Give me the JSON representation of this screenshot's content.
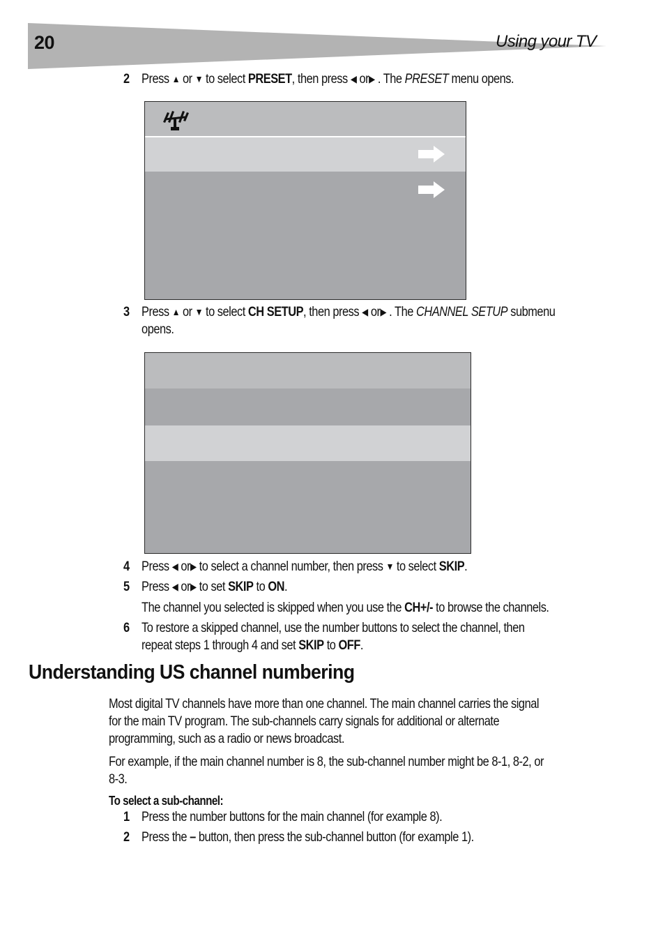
{
  "header": {
    "page_number": "20",
    "running_head": "Using your TV",
    "band_color": "#b3b3b3"
  },
  "steps_a": [
    {
      "number": "2",
      "parts": {
        "p1": "Press ",
        "up_icon": "▲",
        "p2": " or ",
        "down_icon": "▼",
        "p3": " to select ",
        "b1": "PRESET",
        "p4": ", then press ",
        "left_icon": "◀",
        "p5": " or",
        "right_icon": "▶",
        "p6": " . The ",
        "i1": "PRESET",
        "p7": " menu opens."
      }
    },
    {
      "number": "3",
      "parts": {
        "p1": "Press ",
        "up_icon": "▲",
        "p2": " or ",
        "down_icon": "▼",
        "p3": " to select ",
        "b1": "CH SETUP",
        "p4": ", then press ",
        "left_icon": "◀",
        "p5": " or",
        "right_icon": "▶",
        "p6": " . The ",
        "i1": "CHANNEL SETUP",
        "p7": " submenu",
        "line2": "opens."
      }
    }
  ],
  "preset_screen": {
    "header_icon": "antenna-icon",
    "rows": [
      {
        "state": "selected",
        "icon": "arrow-right-icon"
      },
      {
        "state": "normal",
        "icon": "arrow-right-icon"
      }
    ],
    "colors": {
      "header": "#bbbcbe",
      "selected": "#d1d2d4",
      "body": "#a7a8ab"
    }
  },
  "channel_setup_screen": {
    "rows": [
      {
        "state": "header"
      },
      {
        "state": "normal"
      },
      {
        "state": "selected"
      },
      {
        "state": "normal"
      }
    ]
  },
  "steps_b": [
    {
      "number": "4",
      "parts": {
        "p1": "Press ",
        "left_icon": "◀",
        "p2": " or",
        "right_icon": "▶",
        "p3": "  to select a channel number, then press ",
        "down_icon": "▼",
        "p4": "  to select ",
        "b1": "SKIP",
        "p5": "."
      }
    },
    {
      "number": "5",
      "parts": {
        "p1": "Press ",
        "left_icon": "◀",
        "p2": " or",
        "right_icon": "▶",
        "p3": "  to set ",
        "b1": "SKIP",
        "p4": " to ",
        "b2": "ON",
        "p5": "."
      },
      "note": {
        "p1": "The channel you selected is skipped when you use the ",
        "b1": "CH+/-",
        "p2": " to browse the channels."
      }
    },
    {
      "number": "6",
      "line1": "To restore a skipped channel, use the number buttons to select the channel, then",
      "parts": {
        "p1": "repeat steps 1 through 4 and set ",
        "b1": "SKIP",
        "p2": " to ",
        "b2": "OFF",
        "p3": "."
      }
    }
  ],
  "section": {
    "title": "Understanding US channel numbering",
    "paragraphs": [
      [
        "Most digital TV channels have more than one channel. The main channel carries the signal",
        "for the main TV program. The sub-channels carry signals for additional or alternate",
        "programming, such as a radio or news broadcast."
      ],
      [
        "For example, if the main channel number is 8, the sub-channel number might be 8-1, 8-2, or",
        "8-3."
      ]
    ],
    "procedure_title": "To select a sub-channel:",
    "procedure_steps": [
      {
        "number": "1",
        "text": "Press the number buttons for the main channel (for example 8)."
      },
      {
        "number": "2",
        "p1": "Press the ",
        "b1": "–",
        "p2": " button, then press the sub-channel button (for example 1)."
      }
    ]
  }
}
